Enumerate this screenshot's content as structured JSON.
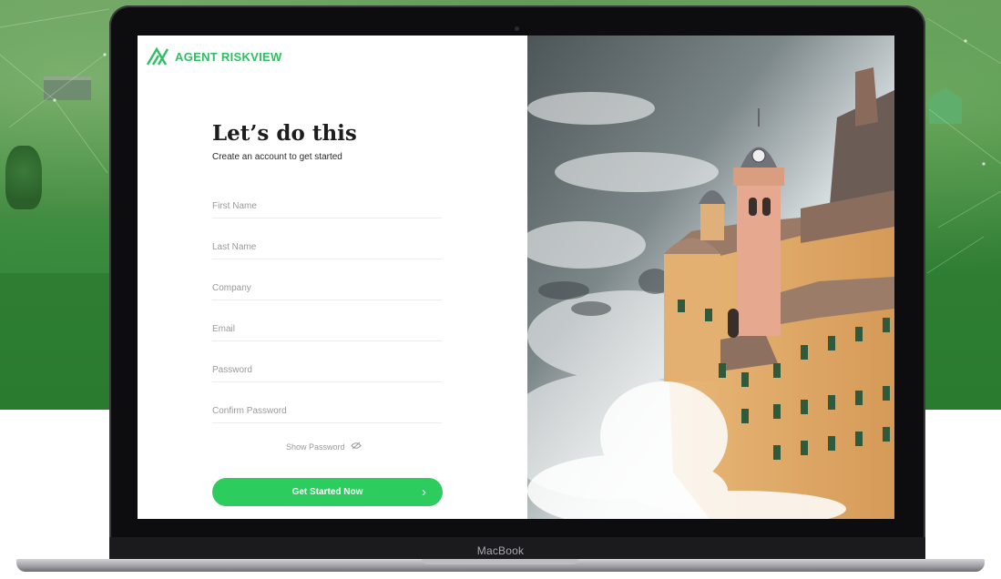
{
  "device": {
    "label": "MacBook"
  },
  "brand": {
    "name": "AGENT RISKVIEW",
    "accent": "#2fbf63"
  },
  "form": {
    "title": "Let’s do this",
    "subtitle": "Create an account to get started",
    "fields": {
      "first_name": "First Name",
      "last_name": "Last Name",
      "company": "Company",
      "email": "Email",
      "password": "Password",
      "confirm_password": "Confirm Password"
    },
    "show_password": "Show Password",
    "submit": "Get Started Now",
    "button_color": "#2ccd5e"
  },
  "icons": {
    "logo": "riskview-logo-icon",
    "show_password": "eye-off-icon",
    "submit": "chevron-right-icon"
  }
}
